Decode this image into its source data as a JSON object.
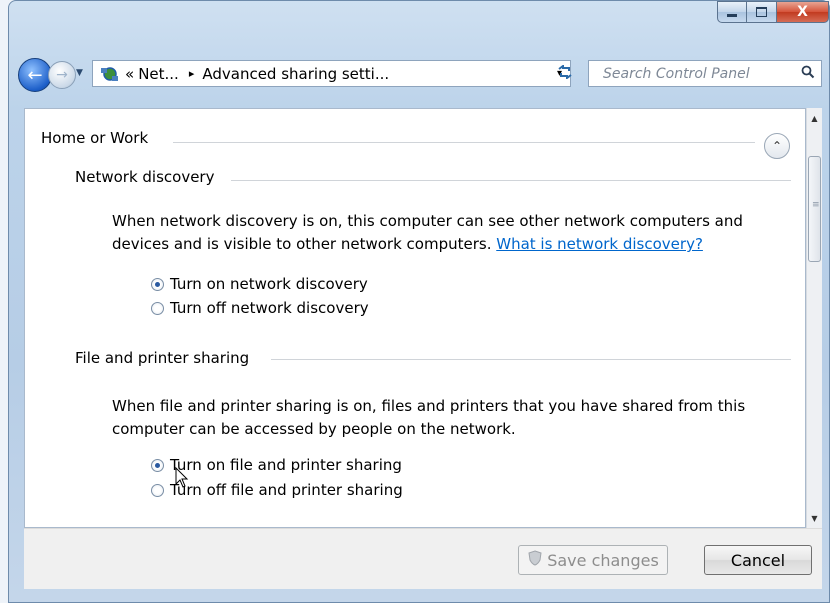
{
  "window": {
    "minimize_icon": "minimize-icon",
    "maximize_icon": "maximize-icon",
    "close_label": "X"
  },
  "toolbar": {
    "address_prefix": "«",
    "address_segment1": "Net...",
    "address_separator": "▸",
    "address_segment2": "Advanced sharing setti...",
    "address_dropdown": "▾",
    "refresh_label": "⁴↳",
    "search_placeholder": "Search Control Panel"
  },
  "content": {
    "profile_title": "Home or Work",
    "network_discovery": {
      "title": "Network discovery",
      "description": "When network discovery is on, this computer can see other network computers and devices and is visible to other network computers.",
      "link": "What is network discovery?",
      "options": [
        {
          "label": "Turn on network discovery",
          "checked": true
        },
        {
          "label": "Turn off network discovery",
          "checked": false
        }
      ]
    },
    "file_printer_sharing": {
      "title": "File and printer sharing",
      "description": "When file and printer sharing is on, files and printers that you have shared from this computer can be accessed by people on the network.",
      "options": [
        {
          "label": "Turn on file and printer sharing",
          "checked": true
        },
        {
          "label": "Turn off file and printer sharing",
          "checked": false
        }
      ]
    }
  },
  "footer": {
    "save_label": "Save changes",
    "cancel_label": "Cancel"
  },
  "colors": {
    "link": "#0066cc",
    "window_frame": "#bcd3ea",
    "close_button": "#c23a20"
  }
}
